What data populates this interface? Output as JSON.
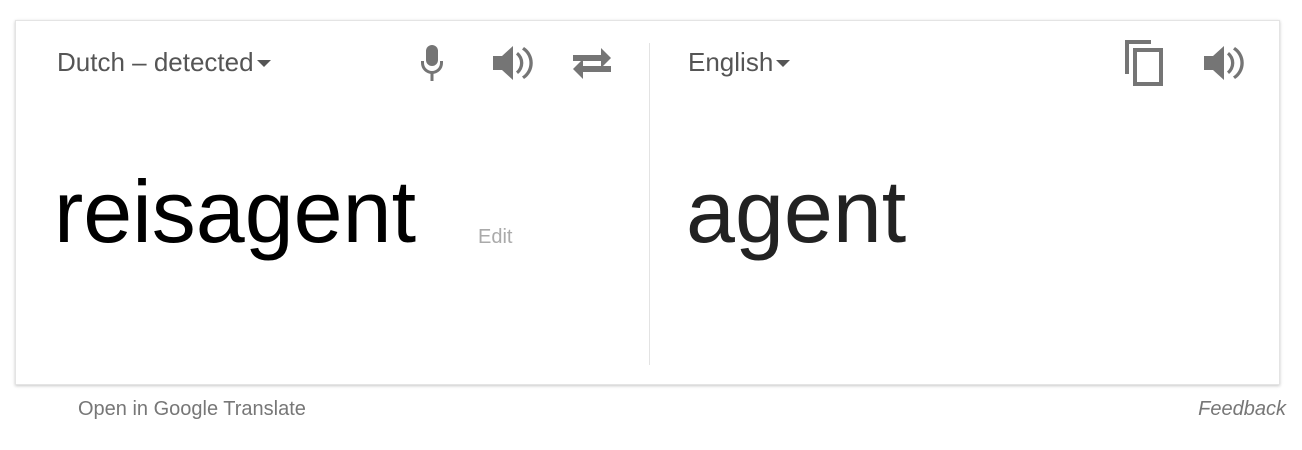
{
  "source": {
    "language": "Dutch – detected",
    "text": "reisagent",
    "edit_label": "Edit"
  },
  "target": {
    "language": "English",
    "text": "agent"
  },
  "icons": {
    "mic": "microphone-icon",
    "speaker": "speaker-icon",
    "swap": "swap-languages-icon",
    "copy": "copy-icon"
  },
  "footer": {
    "open_link": "Open in Google Translate",
    "feedback": "Feedback"
  },
  "colors": {
    "icon": "#757575",
    "label": "#555555",
    "muted": "#aaaaaa"
  }
}
